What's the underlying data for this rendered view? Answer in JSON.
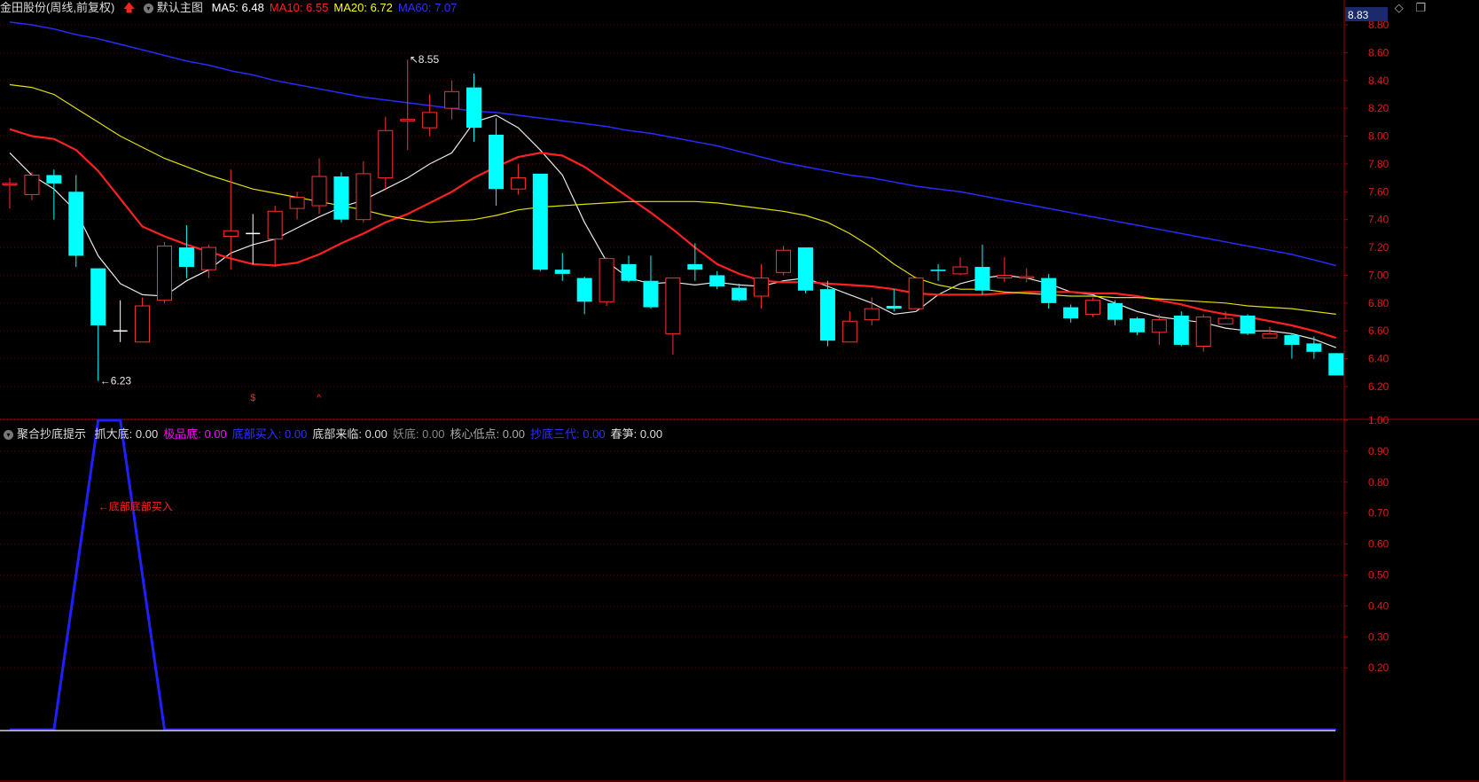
{
  "header_main": {
    "stock": "金田股份",
    "period": "(周线,前复权)",
    "template": "默认主图",
    "ma": [
      {
        "label": "MA5",
        "value": "6.48",
        "color": "#ffffff"
      },
      {
        "label": "MA10",
        "value": "6.55",
        "color": "#ff2020"
      },
      {
        "label": "MA20",
        "value": "6.72",
        "color": "#ffff00"
      },
      {
        "label": "MA60",
        "value": "7.07",
        "color": "#3030ff"
      }
    ]
  },
  "header_sub": {
    "name": "聚合抄底提示",
    "items": [
      {
        "label": "抓大底",
        "value": "0.00",
        "color": "#dddddd"
      },
      {
        "label": "极品底",
        "value": "0.00",
        "color": "#ff00ff"
      },
      {
        "label": "底部买入",
        "value": "0.00",
        "color": "#3030ff"
      },
      {
        "label": "底部来临",
        "value": "0.00",
        "color": "#dddddd"
      },
      {
        "label": "妖底",
        "value": "0.00",
        "color": "#888888"
      },
      {
        "label": "核心低点",
        "value": "0.00",
        "color": "#aaaaaa"
      },
      {
        "label": "抄底三代",
        "value": "0.00",
        "color": "#3030ff"
      },
      {
        "label": "春笋",
        "value": "0.00",
        "color": "#dddddd"
      }
    ]
  },
  "top_right_price": "8.83",
  "top_icons": [
    "diamond-icon",
    "window-restore-icon"
  ],
  "chart_data": [
    {
      "type": "candlestick",
      "ylim": [
        6.1,
        8.9
      ],
      "yticks": [
        "8.80",
        "8.60",
        "8.40",
        "8.20",
        "8.00",
        "7.80",
        "7.60",
        "7.40",
        "7.20",
        "7.00",
        "6.80",
        "6.60",
        "6.40",
        "6.20"
      ],
      "candles": [
        [
          7.65,
          7.66,
          7.48,
          7.7
        ],
        [
          7.58,
          7.72,
          7.54,
          7.74
        ],
        [
          7.72,
          7.66,
          7.4,
          7.76
        ],
        [
          7.6,
          7.14,
          7.06,
          7.72
        ],
        [
          7.05,
          6.64,
          6.24,
          7.05
        ],
        [
          6.6,
          6.6,
          6.52,
          6.82
        ],
        [
          6.52,
          6.78,
          6.52,
          6.84
        ],
        [
          6.82,
          7.21,
          6.8,
          7.24
        ],
        [
          7.2,
          7.06,
          6.98,
          7.36
        ],
        [
          7.04,
          7.2,
          6.98,
          7.22
        ],
        [
          7.28,
          7.32,
          7.04,
          7.76
        ],
        [
          7.3,
          7.3,
          7.08,
          7.44
        ],
        [
          7.26,
          7.46,
          7.06,
          7.5
        ],
        [
          7.48,
          7.56,
          7.4,
          7.6
        ],
        [
          7.5,
          7.71,
          7.44,
          7.84
        ],
        [
          7.71,
          7.4,
          7.38,
          7.74
        ],
        [
          7.4,
          7.73,
          7.38,
          7.82
        ],
        [
          7.7,
          8.04,
          7.62,
          8.14
        ],
        [
          8.11,
          8.12,
          7.9,
          8.55
        ],
        [
          8.06,
          8.17,
          8.0,
          8.3
        ],
        [
          8.2,
          8.32,
          8.12,
          8.4
        ],
        [
          8.35,
          8.06,
          7.96,
          8.45
        ],
        [
          8.01,
          7.62,
          7.5,
          8.13
        ],
        [
          7.62,
          7.7,
          7.58,
          7.8
        ],
        [
          7.73,
          7.04,
          7.03,
          7.73
        ],
        [
          7.04,
          7.01,
          6.96,
          7.16
        ],
        [
          6.98,
          6.81,
          6.72,
          6.99
        ],
        [
          6.81,
          7.12,
          6.78,
          7.13
        ],
        [
          7.08,
          6.96,
          6.95,
          7.14
        ],
        [
          6.96,
          6.77,
          6.76,
          7.14
        ],
        [
          6.58,
          6.98,
          6.43,
          6.98
        ],
        [
          7.08,
          7.04,
          6.96,
          7.23
        ],
        [
          7.0,
          6.92,
          6.9,
          7.03
        ],
        [
          6.91,
          6.82,
          6.81,
          6.94
        ],
        [
          6.85,
          6.98,
          6.76,
          7.08
        ],
        [
          7.02,
          7.18,
          7.0,
          7.21
        ],
        [
          7.2,
          6.89,
          6.87,
          7.2
        ],
        [
          6.9,
          6.53,
          6.49,
          6.96
        ],
        [
          6.52,
          6.67,
          6.52,
          6.74
        ],
        [
          6.68,
          6.76,
          6.64,
          6.84
        ],
        [
          6.78,
          6.76,
          6.74,
          6.9
        ],
        [
          6.76,
          6.98,
          6.76,
          6.99
        ],
        [
          7.04,
          7.03,
          6.96,
          7.08
        ],
        [
          7.01,
          7.06,
          7.0,
          7.13
        ],
        [
          7.06,
          6.89,
          6.86,
          7.22
        ],
        [
          6.98,
          7.0,
          6.95,
          7.13
        ],
        [
          6.98,
          6.99,
          6.95,
          7.05
        ],
        [
          6.98,
          6.8,
          6.76,
          7.01
        ],
        [
          6.77,
          6.69,
          6.66,
          6.79
        ],
        [
          6.72,
          6.82,
          6.7,
          6.84
        ],
        [
          6.8,
          6.68,
          6.64,
          6.82
        ],
        [
          6.69,
          6.59,
          6.57,
          6.7
        ],
        [
          6.59,
          6.68,
          6.5,
          6.72
        ],
        [
          6.71,
          6.5,
          6.49,
          6.74
        ],
        [
          6.49,
          6.7,
          6.45,
          6.72
        ],
        [
          6.65,
          6.69,
          6.65,
          6.74
        ],
        [
          6.71,
          6.58,
          6.57,
          6.72
        ],
        [
          6.55,
          6.58,
          6.55,
          6.63
        ],
        [
          6.57,
          6.5,
          6.4,
          6.58
        ],
        [
          6.51,
          6.45,
          6.4,
          6.56
        ],
        [
          6.44,
          6.28,
          6.28,
          6.44
        ]
      ],
      "ma": {
        "MA5": [
          7.88,
          7.72,
          7.62,
          7.46,
          7.14,
          6.94,
          6.86,
          6.85,
          6.96,
          7.04,
          7.16,
          7.22,
          7.26,
          7.34,
          7.42,
          7.49,
          7.54,
          7.62,
          7.7,
          7.8,
          7.88,
          8.1,
          8.15,
          8.06,
          7.9,
          7.72,
          7.38,
          7.1,
          6.98,
          6.94,
          6.95,
          6.93,
          6.95,
          6.93,
          6.92,
          6.96,
          6.98,
          6.92,
          6.86,
          6.8,
          6.72,
          6.74,
          6.86,
          6.94,
          6.98,
          7.0,
          6.98,
          6.94,
          6.88,
          6.86,
          6.8,
          6.74,
          6.7,
          6.68,
          6.66,
          6.62,
          6.6,
          6.6,
          6.58,
          6.54,
          6.48
        ],
        "MA10": [
          8.05,
          8.0,
          7.98,
          7.9,
          7.75,
          7.55,
          7.35,
          7.28,
          7.22,
          7.17,
          7.12,
          7.08,
          7.07,
          7.09,
          7.15,
          7.23,
          7.3,
          7.38,
          7.44,
          7.52,
          7.6,
          7.7,
          7.78,
          7.85,
          7.88,
          7.86,
          7.78,
          7.67,
          7.56,
          7.45,
          7.33,
          7.2,
          7.08,
          7.01,
          6.96,
          6.95,
          6.95,
          6.94,
          6.93,
          6.92,
          6.9,
          6.87,
          6.86,
          6.86,
          6.86,
          6.87,
          6.88,
          6.88,
          6.88,
          6.87,
          6.87,
          6.85,
          6.82,
          6.79,
          6.75,
          6.72,
          6.7,
          6.67,
          6.64,
          6.6,
          6.55
        ],
        "MA20": [
          8.37,
          8.35,
          8.3,
          8.2,
          8.1,
          8.0,
          7.92,
          7.84,
          7.78,
          7.72,
          7.67,
          7.62,
          7.59,
          7.56,
          7.53,
          7.5,
          7.47,
          7.43,
          7.4,
          7.38,
          7.39,
          7.4,
          7.43,
          7.47,
          7.49,
          7.5,
          7.51,
          7.52,
          7.53,
          7.53,
          7.53,
          7.53,
          7.52,
          7.5,
          7.48,
          7.46,
          7.43,
          7.38,
          7.3,
          7.2,
          7.08,
          6.98,
          6.93,
          6.9,
          6.9,
          6.88,
          6.87,
          6.86,
          6.85,
          6.85,
          6.84,
          6.84,
          6.83,
          6.82,
          6.81,
          6.8,
          6.78,
          6.77,
          6.76,
          6.74,
          6.72
        ],
        "MA60": [
          8.82,
          8.8,
          8.77,
          8.73,
          8.7,
          8.66,
          8.62,
          8.58,
          8.54,
          8.51,
          8.47,
          8.44,
          8.4,
          8.37,
          8.34,
          8.31,
          8.28,
          8.26,
          8.24,
          8.22,
          8.2,
          8.18,
          8.17,
          8.15,
          8.13,
          8.11,
          8.09,
          8.07,
          8.04,
          8.02,
          7.99,
          7.96,
          7.93,
          7.89,
          7.85,
          7.81,
          7.78,
          7.75,
          7.72,
          7.7,
          7.67,
          7.64,
          7.62,
          7.6,
          7.57,
          7.54,
          7.51,
          7.48,
          7.45,
          7.42,
          7.39,
          7.36,
          7.33,
          7.3,
          7.27,
          7.24,
          7.21,
          7.18,
          7.15,
          7.11,
          7.07
        ]
      },
      "annotations": [
        {
          "label": "8.55",
          "index": 18,
          "price": 8.55,
          "side": "high"
        },
        {
          "label": "6.23",
          "index": 4,
          "price": 6.24,
          "side": "low"
        }
      ],
      "markers": [
        {
          "label": "$",
          "index": 11,
          "color": "#ff2020"
        },
        {
          "label": "^",
          "index": 14,
          "color": "#ff2020"
        }
      ]
    },
    {
      "type": "line",
      "ylim": [
        0,
        1.05
      ],
      "yticks": [
        "1.00",
        "0.90",
        "0.80",
        "0.70",
        "0.60",
        "0.50",
        "0.40",
        "0.30",
        "0.20"
      ],
      "series": [
        {
          "name": "底部买入",
          "color": "#2020ff",
          "values": [
            0,
            0,
            0,
            0.5,
            1,
            1,
            0.5,
            0,
            0,
            0,
            0,
            0,
            0,
            0,
            0,
            0,
            0,
            0,
            0,
            0,
            0,
            0,
            0,
            0,
            0,
            0,
            0,
            0,
            0,
            0,
            0,
            0,
            0,
            0,
            0,
            0,
            0,
            0,
            0,
            0,
            0,
            0,
            0,
            0,
            0,
            0,
            0,
            0,
            0,
            0,
            0,
            0,
            0,
            0,
            0,
            0,
            0,
            0,
            0,
            0,
            0
          ]
        }
      ],
      "annotations": [
        {
          "label": "←底部底部买入",
          "index": 4,
          "value": 0.72
        }
      ]
    }
  ]
}
